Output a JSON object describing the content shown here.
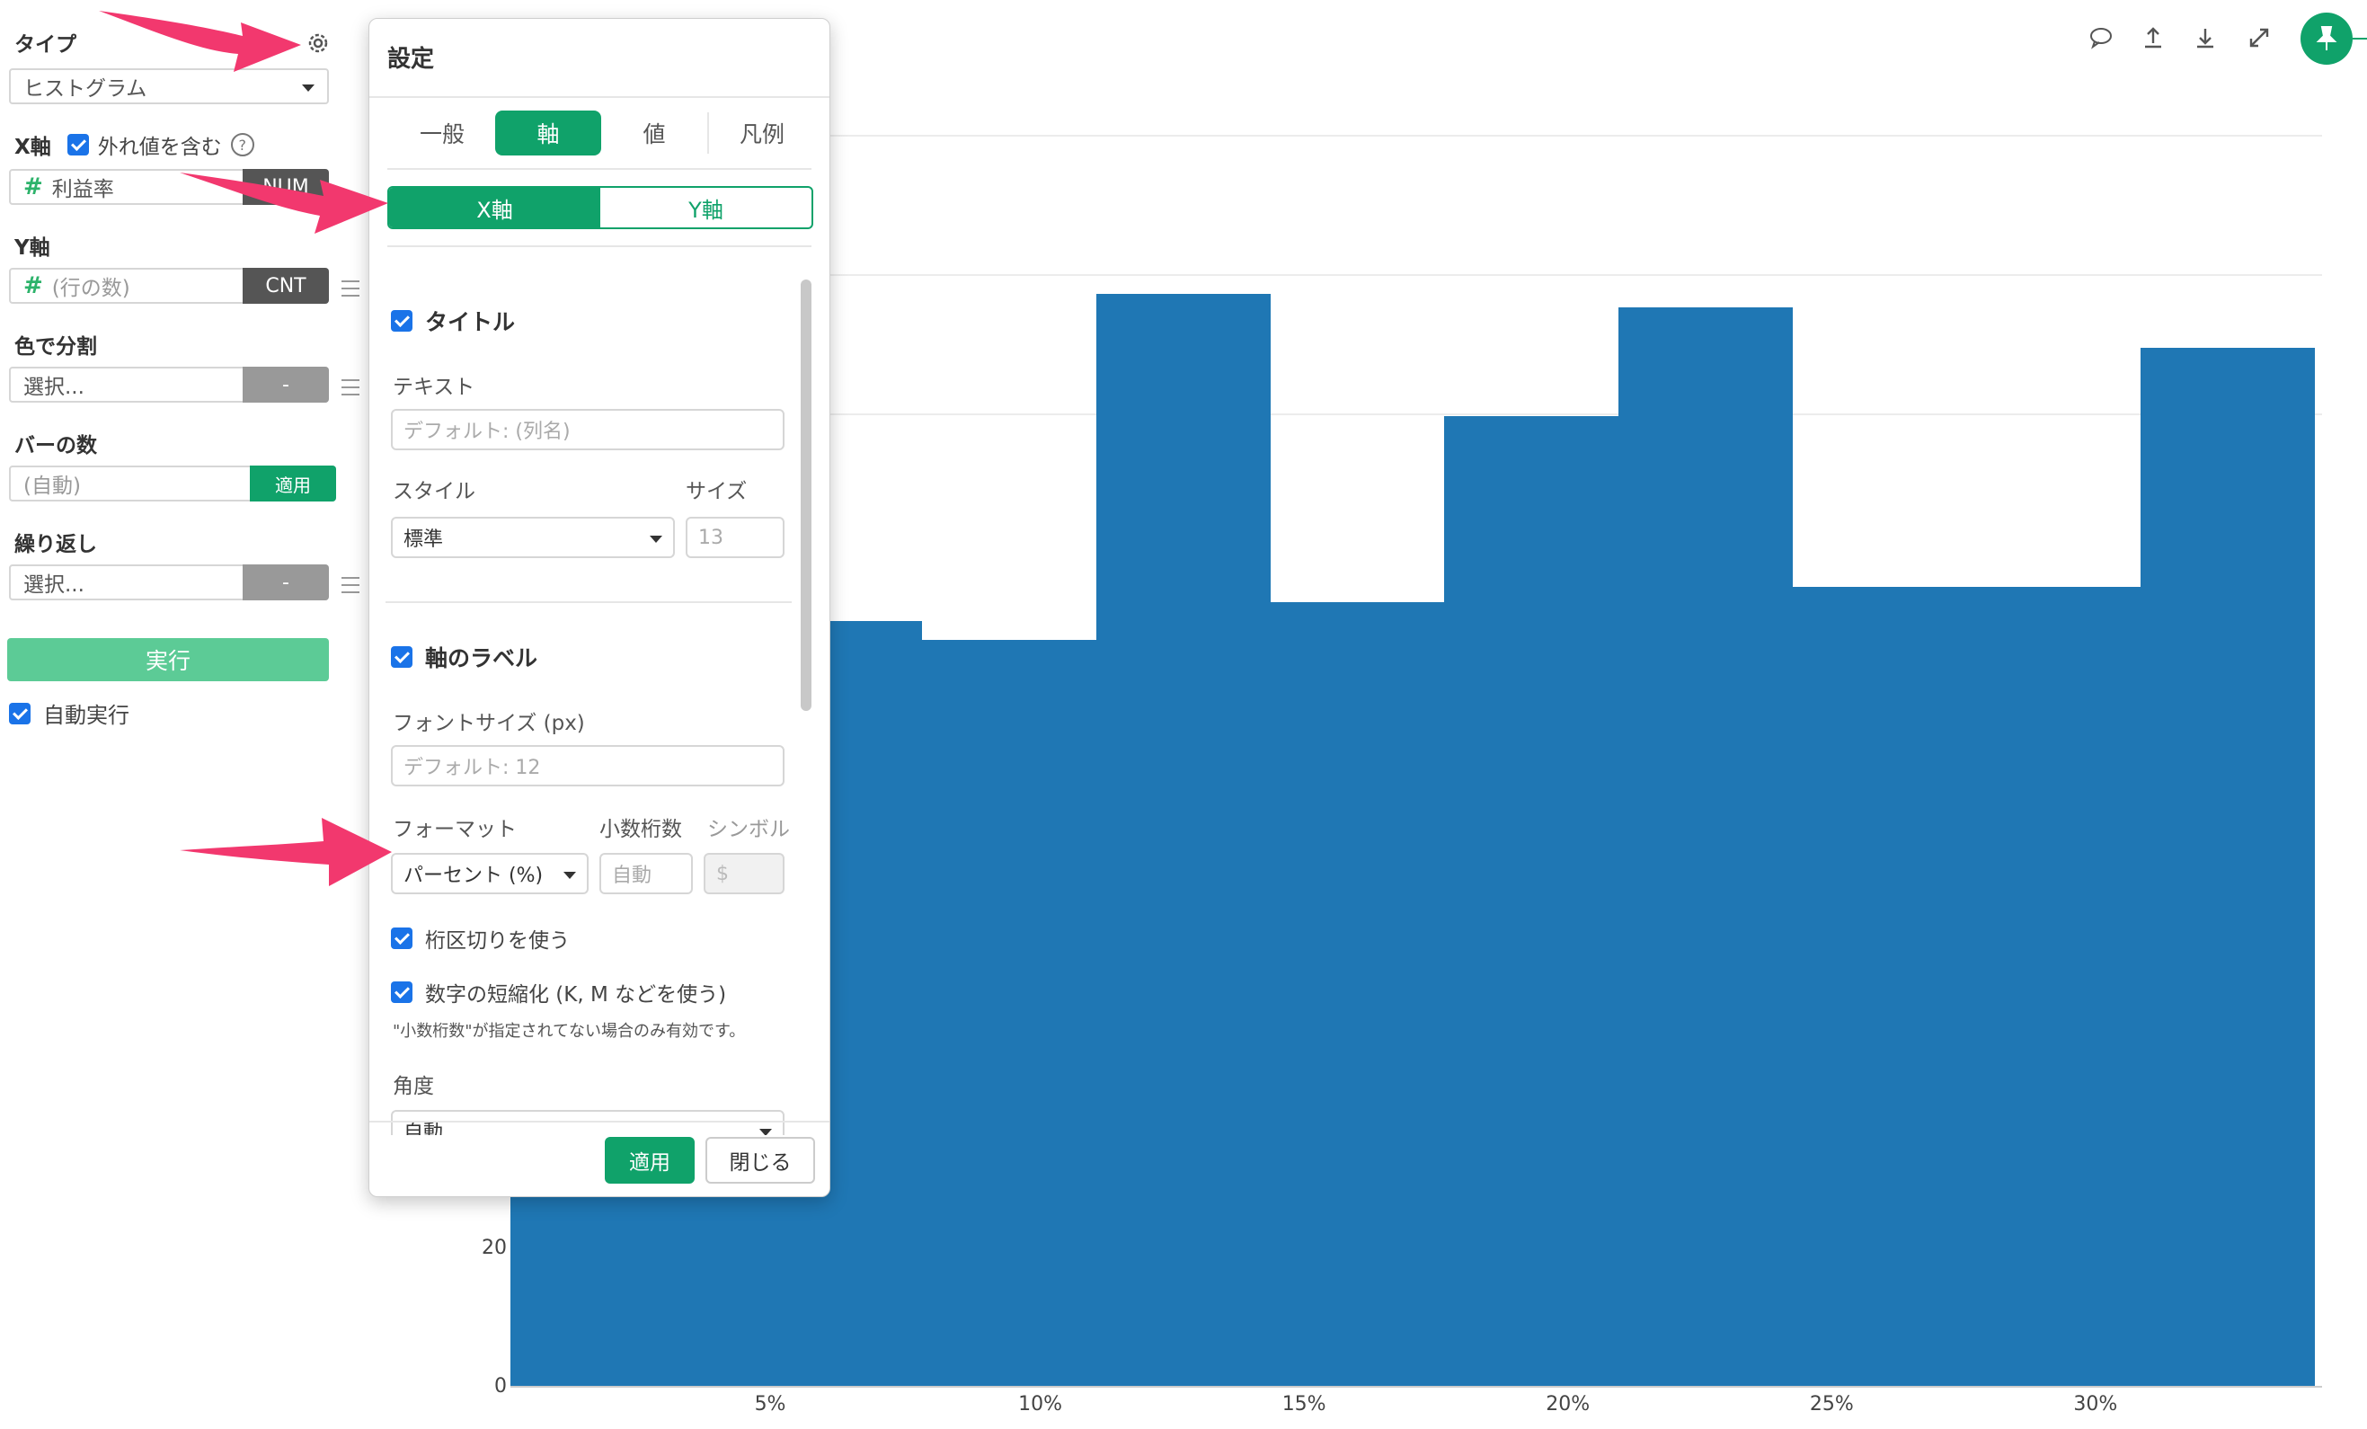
{
  "sidebar": {
    "type_label": "タイプ",
    "type_value": "ヒストグラム",
    "x_axis_label": "X軸",
    "include_outliers_label": "外れ値を含む",
    "x_field": {
      "prefix": "#",
      "name": "利益率",
      "tag": "NUM"
    },
    "y_axis_label": "Y軸",
    "y_field": {
      "prefix": "#",
      "name": "(行の数)",
      "tag": "CNT"
    },
    "color_split_label": "色で分割",
    "color_split_placeholder": "選択...",
    "color_split_tag": "-",
    "bins_label": "バーの数",
    "bins_placeholder": "(自動)",
    "bins_apply": "適用",
    "repeat_label": "繰り返し",
    "repeat_placeholder": "選択...",
    "repeat_tag": "-",
    "run_button": "実行",
    "auto_run_label": "自動実行"
  },
  "modal": {
    "title": "設定",
    "tabs": [
      "一般",
      "軸",
      "値",
      "凡例"
    ],
    "active_tab": "軸",
    "axis_segments": [
      "X軸",
      "Y軸"
    ],
    "title_section": {
      "heading": "タイトル",
      "text_label": "テキスト",
      "text_placeholder": "デフォルト: (列名)",
      "style_label": "スタイル",
      "style_value": "標準",
      "size_label": "サイズ",
      "size_placeholder": "13"
    },
    "axis_label_section": {
      "heading": "軸のラベル",
      "font_size_label": "フォントサイズ (px)",
      "font_size_placeholder": "デフォルト: 12",
      "format_label": "フォーマット",
      "format_value": "パーセント (%)",
      "decimals_label": "小数桁数",
      "decimals_placeholder": "自動",
      "symbol_label": "シンボル",
      "symbol_placeholder": "$",
      "thousands_separator": "桁区切りを使う",
      "abbreviate": "数字の短縮化 (K, M などを使う)",
      "abbreviate_note": "\"小数桁数\"が指定されてない場合のみ有効です。",
      "angle_label": "角度",
      "angle_value": "自動"
    },
    "apply_button": "適用",
    "close_button": "閉じる"
  },
  "chart_data": {
    "type": "bar",
    "x_ticks": [
      "5%",
      "10%",
      "15%",
      "20%",
      "25%",
      "30%"
    ],
    "y_ticks_visible": [
      "0",
      "20"
    ],
    "bars": [
      {
        "x_start": 0.0,
        "x_end": 4.5,
        "height_fraction": 0.62
      },
      {
        "x_start": 4.5,
        "x_end": 7.8,
        "height_fraction": 0.611
      },
      {
        "x_start": 7.8,
        "x_end": 11.1,
        "height_fraction": 0.596
      },
      {
        "x_start": 11.1,
        "x_end": 14.4,
        "height_fraction": 0.8725
      },
      {
        "x_start": 14.4,
        "x_end": 17.7,
        "height_fraction": 0.6265
      },
      {
        "x_start": 17.7,
        "x_end": 21.0,
        "height_fraction": 0.7755
      },
      {
        "x_start": 21.0,
        "x_end": 24.3,
        "height_fraction": 0.862
      },
      {
        "x_start": 24.3,
        "x_end": 27.6,
        "height_fraction": 0.639
      },
      {
        "x_start": 27.6,
        "x_end": 30.9,
        "height_fraction": 0.639
      },
      {
        "x_start": 30.9,
        "x_end": 34.2,
        "height_fraction": 0.8295
      }
    ],
    "bar_color": "#1f77b4"
  },
  "colors": {
    "accent": "#10a26a",
    "arrow": "#f2386e",
    "bar": "#1f77b4"
  },
  "toolbar_icons": [
    "comment-icon",
    "upload-icon",
    "download-icon",
    "expand-icon",
    "pin-icon"
  ]
}
